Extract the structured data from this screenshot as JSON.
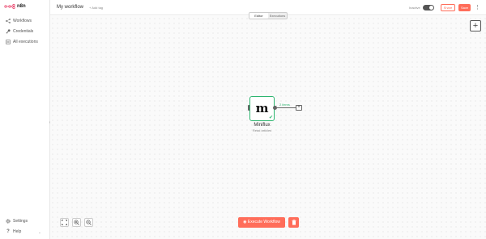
{
  "app": {
    "logo_text": "n8n"
  },
  "sidebar": {
    "items": [
      {
        "label": "Workflows",
        "icon": "network-icon"
      },
      {
        "label": "Credentials",
        "icon": "key-icon"
      },
      {
        "label": "All executions",
        "icon": "list-icon"
      }
    ],
    "bottom": [
      {
        "label": "Settings",
        "icon": "gear-icon"
      },
      {
        "label": "Help",
        "icon": "question-icon"
      }
    ]
  },
  "header": {
    "workflow_name": "My workflow",
    "add_tag": "+ Add tag",
    "active_label": "Inactive",
    "share_label": "Share",
    "save_label": "Save"
  },
  "tabs": [
    {
      "label": "Editor",
      "active": true
    },
    {
      "label": "Executions",
      "active": false
    }
  ],
  "node": {
    "logo": "m",
    "title": "Miniflux",
    "subtitle": "Read articles",
    "output_items": "2 items"
  },
  "canvas": {
    "execute_label": "Execute Workflow",
    "accent_color": "#ff6d5a",
    "success_color": "#2db56f"
  }
}
